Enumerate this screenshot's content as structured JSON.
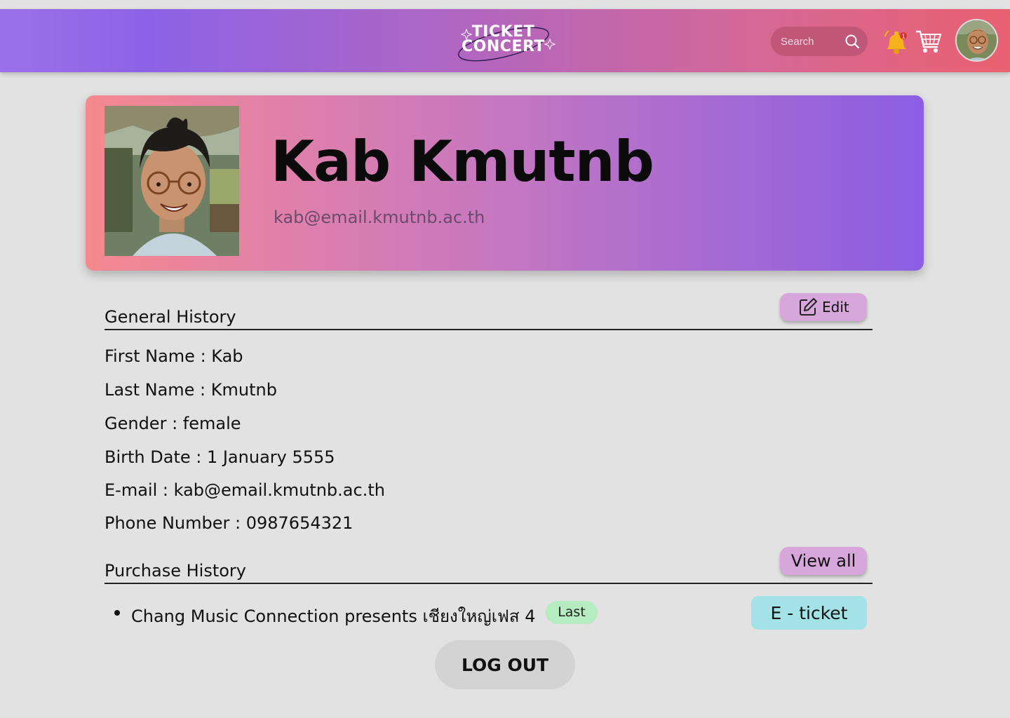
{
  "header": {
    "logo_line1": "TICKET",
    "logo_line2": "CONCERT",
    "search_placeholder": "Search",
    "notification_count": "1",
    "icons": [
      "search-icon",
      "bell-icon",
      "cart-icon",
      "avatar"
    ]
  },
  "profile": {
    "name": "Kab Kmutnb",
    "email": "kab@email.kmutnb.ac.th"
  },
  "general_history": {
    "title": "General History",
    "edit_label": "Edit",
    "fields": [
      "First Name : Kab",
      "Last Name : Kmutnb",
      "Gender : female",
      "Birth Date : 1 January 5555",
      "E-mail : kab@email.kmutnb.ac.th",
      "Phone Number : 0987654321"
    ]
  },
  "purchase_history": {
    "title": "Purchase History",
    "view_all_label": "View all",
    "items": [
      {
        "event": "Chang Music Connection presents เชียงใหญ่เฟส 4",
        "badge": "Last",
        "action_label": "E - ticket"
      }
    ]
  },
  "logout_label": "LOG OUT",
  "colors": {
    "header_gradient_start": "#9a70ea",
    "header_gradient_end": "#ea6170",
    "card_gradient_start": "#f4898e",
    "card_gradient_end": "#8b5ee4",
    "edit_button": "#d7a7dc",
    "badge": "#b5ecc0",
    "eticket_button": "#a3e2e6",
    "logout_button": "#d3d3d3",
    "page_bg": "#e2e2e2"
  }
}
